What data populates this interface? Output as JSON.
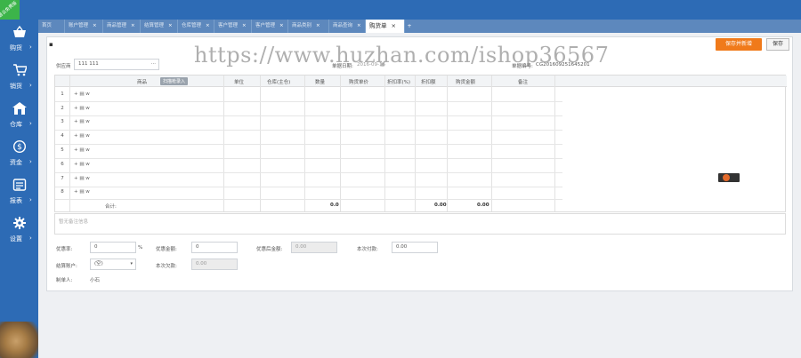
{
  "corner_badge": "普云免费版",
  "sidebar": {
    "items": [
      {
        "label": "购货",
        "icon": "basket-icon"
      },
      {
        "label": "销货",
        "icon": "cart-icon"
      },
      {
        "label": "仓库",
        "icon": "warehouse-icon"
      },
      {
        "label": "资金",
        "icon": "dollar-icon"
      },
      {
        "label": "报表",
        "icon": "report-icon"
      },
      {
        "label": "设置",
        "icon": "gear-icon"
      }
    ],
    "arrow": "›"
  },
  "tabs": {
    "items": [
      {
        "label": "首页"
      },
      {
        "label": "账户管理"
      },
      {
        "label": "商品管理"
      },
      {
        "label": "结算管理"
      },
      {
        "label": "仓库管理"
      },
      {
        "label": "客户管理"
      },
      {
        "label": "客户管理"
      },
      {
        "label": "商品类别"
      },
      {
        "label": "商品查询"
      }
    ],
    "active": "购货单",
    "close": "×",
    "add": "+"
  },
  "toolbar": {
    "save_add_label": "保存并新增",
    "save_label": "保存"
  },
  "form": {
    "supplier_label": "供应商",
    "supplier_value": "111 111",
    "date_label": "单据日期:",
    "date_value": "2016-09-16",
    "bill_no_label": "单据编号:",
    "bill_no_value": "CG201609251645201"
  },
  "grid": {
    "columns": [
      "商品",
      "单位",
      "仓库(主仓)",
      "数量",
      "购货单价",
      "折扣率(%)",
      "折扣额",
      "购货金额",
      "备注"
    ],
    "scan_label": "扫描枪录入",
    "row_numbers": [
      "1",
      "2",
      "3",
      "4",
      "5",
      "6",
      "7",
      "8"
    ],
    "row_ops": [
      "+ ▤ w",
      "+ ▤ w",
      "+ ▤ w",
      "+ ▤ w",
      "+ ▤ w",
      "+ ▤ w",
      "+ ▤ w",
      "+ ▤ w"
    ],
    "total_label": "合计:",
    "total_quantity": "0.0",
    "total_discount": "0.00",
    "total_amount": "0.00"
  },
  "remark_placeholder": "暂无备注信息",
  "footer": {
    "discount_rate_label": "优惠率:",
    "discount_rate_value": "0",
    "percent": "%",
    "discount_amount_label": "优惠金额:",
    "discount_amount_value": "0",
    "after_discount_label": "优惠后金额:",
    "after_discount_value": "0.00",
    "paid_label": "本次付款:",
    "paid_value": "0.00",
    "account_label": "结算账户:",
    "account_value": "(空)",
    "debt_label": "本次欠款:",
    "debt_value": "0.00",
    "maker_label": "制单人:",
    "maker_value": "小石"
  },
  "watermark": "https://www.huzhan.com/ishop36567"
}
